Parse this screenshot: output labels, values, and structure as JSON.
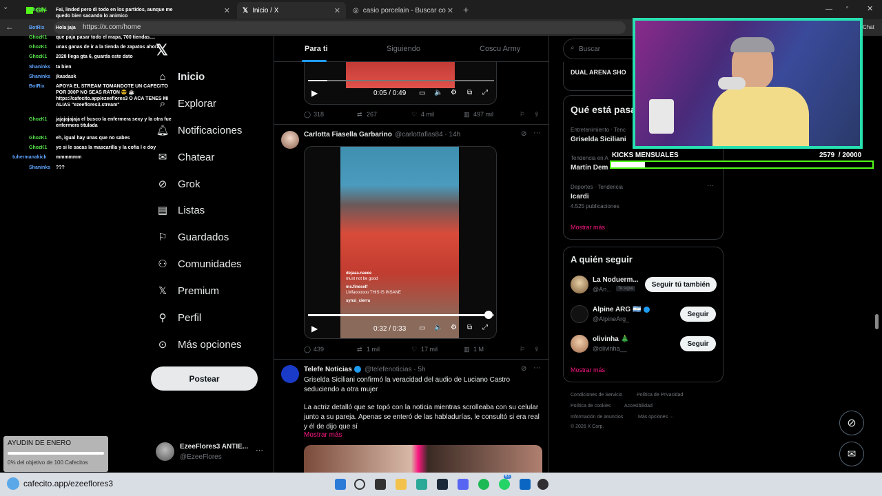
{
  "browser": {
    "tabs": [
      {
        "label": "Gh",
        "x_hint": "",
        "close": "✕"
      },
      {
        "label": "Inicio / X",
        "close": "✕"
      },
      {
        "label": "casio porcelain - Buscar con Goog",
        "close": "✕"
      }
    ],
    "new_tab": "+",
    "url": "https://x.com/home",
    "chat_btn": "Chat"
  },
  "nav": {
    "items": [
      {
        "label": "Inicio",
        "icon": "home-icon"
      },
      {
        "label": "Explorar",
        "icon": "search-icon"
      },
      {
        "label": "Notificaciones",
        "icon": "bell-icon"
      },
      {
        "label": "Chatear",
        "icon": "mail-icon"
      },
      {
        "label": "Grok",
        "icon": "grok-icon"
      },
      {
        "label": "Listas",
        "icon": "list-icon"
      },
      {
        "label": "Guardados",
        "icon": "bookmark-icon"
      },
      {
        "label": "Comunidades",
        "icon": "communities-icon"
      },
      {
        "label": "Premium",
        "icon": "x-logo-icon"
      },
      {
        "label": "Perfil",
        "icon": "person-icon"
      },
      {
        "label": "Más opciones",
        "icon": "more-circle-icon"
      }
    ],
    "post_button": "Postear",
    "account": {
      "name": "EzeeFlores3 ANTIE...",
      "handle": "@EzeeFlores",
      "more": "···"
    }
  },
  "feed": {
    "tabs": [
      "Para ti",
      "Siguiendo",
      "Coscu Army"
    ],
    "post1": {
      "time": "0:05 / 0:49",
      "stats": {
        "replies": "318",
        "reposts": "267",
        "likes": "4 mil",
        "views": "497 mil"
      }
    },
    "post2": {
      "author": "Carlotta Fiasella Garbarino",
      "handle": "@carlottafias84 · 14h",
      "time": "0:32 / 0:33",
      "progress": 0.97,
      "comments": [
        {
          "user": "dejaaa.naeee",
          "text": "must not be good"
        },
        {
          "user": "ms.fineself",
          "text": "LMfaoooooo THIS IS INSANE"
        },
        {
          "user": "synsi_cierra",
          "text": ""
        }
      ],
      "stats": {
        "replies": "439",
        "reposts": "1 mil",
        "likes": "17 mil",
        "views": "1 M"
      }
    },
    "post3": {
      "author": "Telefe Noticias",
      "handle": "@telefenoticias · 5h",
      "text1": "Griselda Siciliani confirmó la veracidad del audio de Luciano Castro seduciendo a otra mujer",
      "text2": "La actriz detalló que se topó con la noticia mientras scrolleaba con su celular junto a su pareja. Apenas se enteró de las habladurías, le consultó si era real y él de dijo que sí",
      "more": "Mostrar más"
    }
  },
  "sidebar": {
    "search_placeholder": "Buscar",
    "dual_arena": "DUAL ARENA SHO",
    "trends_title": "Qué está pasa",
    "trends": [
      {
        "meta": "Entretenimiento · Tenc",
        "name": "Griselda Siciliani",
        "count": ""
      },
      {
        "meta": "Tendencia en A",
        "name": "Martín Dem",
        "count": ""
      },
      {
        "meta": "Deportes · Tendencia",
        "name": "Icardi",
        "count": "4.525 publicaciones"
      }
    ],
    "show_more": "Mostrar más",
    "follow_title": "A quién seguir",
    "follow": [
      {
        "name": "La Noduerm...",
        "handle": "@An...",
        "badge": "Te sigue",
        "button": "Seguir tú también"
      },
      {
        "name": "Alpine ARG 🇦🇷",
        "handle": "@AlpineArg_",
        "badge": "",
        "button": "Seguir"
      },
      {
        "name": "olivinha 🎄",
        "handle": "@olivinha__",
        "badge": "",
        "button": "Seguir"
      }
    ],
    "follow_more": "Mostrar más",
    "footer": [
      "Condiciones de Servicio",
      "Política de Privacidad",
      "Política de cookies",
      "Accesibilidad",
      "Información de anuncios",
      "Más opciones ···",
      "© 2026 X Corp."
    ]
  },
  "chat": {
    "lines": [
      {
        "user": "GhozK1",
        "text": "Fai, linded pero di todo en los partidos, aunque me quedo bien sacando lo animico",
        "color": "green"
      },
      {
        "user": "BotRix",
        "text": "Hola jaja",
        "color": "blue"
      },
      {
        "user": "GhozK1",
        "text": "que paja pasar todo el mapa, 700 tiendas....",
        "color": "green"
      },
      {
        "user": "GhozK1",
        "text": "unas ganas de ir a la tienda de zapatos ahora",
        "color": "green"
      },
      {
        "user": "GhozK1",
        "text": "2028 llega gta 6, guarda este dato",
        "color": "green"
      },
      {
        "user": "Shaninks",
        "text": "ta bien",
        "color": "blue"
      },
      {
        "user": "Shaninks",
        "text": "jkasdask",
        "color": "blue"
      },
      {
        "user": "BotRix",
        "text": "APOYA EL STREAM TOMANDOTE UN CAFECITO POR 300P NO SEAS RATON 😎 ☕ https://cafecito.app/ezeeflores3 O ACA TENES MI ALIAS \"ezeeflores3.stream\"",
        "color": "blue"
      },
      {
        "user": "GhozK1",
        "text": "jajajajajaja el busco la enfermera sexy y la otra fue enfermera titulada",
        "color": "green"
      },
      {
        "user": "GhozK1",
        "text": "eh, igual hay unas que no sabes",
        "color": "green"
      },
      {
        "user": "GhozK1",
        "text": "yo si le sacas la mascarilla y la cofia l e doy",
        "color": "green"
      },
      {
        "user": "tuhermanakick",
        "text": "mmmmmm",
        "color": "blue"
      },
      {
        "user": "Shaninks",
        "text": "???",
        "color": "blue"
      }
    ]
  },
  "stream": {
    "kicks_label": "KICKS MENSUALES",
    "kicks_value": "2579  / 20000",
    "kicks_progress": 0.129,
    "goal_title": "AYUDIN DE ENERO",
    "goal_text": "0% del objetivo de 100 Cafecitos",
    "goal_progress": 0
  },
  "taskbar": {
    "cafecito_url": "cafecito.app/ezeeflores3",
    "badge": "63"
  },
  "colors": {
    "accent": "#1d9bf0",
    "cam_border": "#27e0b0",
    "chat_green": "#55e04a",
    "chat_blue": "#60a5ff",
    "link_pink": "#f91880"
  }
}
